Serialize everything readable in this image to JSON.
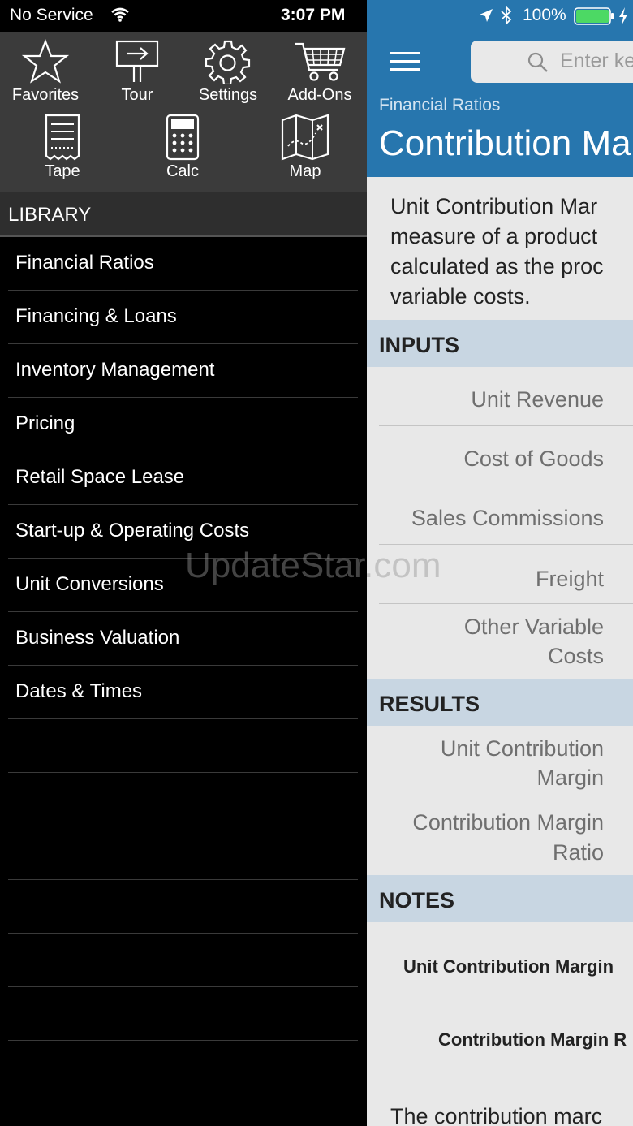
{
  "status_bar": {
    "carrier": "No Service",
    "time": "3:07 PM",
    "battery": "100%"
  },
  "toolbar": {
    "items": [
      {
        "label": "Favorites",
        "icon": "star-icon"
      },
      {
        "label": "Tour",
        "icon": "tour-icon"
      },
      {
        "label": "Settings",
        "icon": "gear-icon"
      },
      {
        "label": "Add-Ons",
        "icon": "cart-icon"
      },
      {
        "label": "Tape",
        "icon": "tape-icon"
      },
      {
        "label": "Calc",
        "icon": "calculator-icon"
      },
      {
        "label": "Map",
        "icon": "map-icon"
      }
    ]
  },
  "library": {
    "header": "LIBRARY",
    "items": [
      "Financial Ratios",
      "Financing & Loans",
      "Inventory Management",
      "Pricing",
      "Retail Space Lease",
      "Start-up & Operating Costs",
      "Unit Conversions",
      "Business Valuation",
      "Dates & Times"
    ]
  },
  "detail": {
    "search_placeholder": "Enter ke",
    "breadcrumb": "Financial Ratios",
    "title": "Contribution Ma",
    "description": [
      "Unit Contribution Mar",
      "measure of a product",
      "calculated as the proc",
      "variable costs."
    ],
    "inputs_header": "INPUTS",
    "inputs": [
      "Unit Revenue",
      "Cost of Goods",
      "Sales Commissions",
      "Freight",
      "Other Variable",
      "Costs"
    ],
    "results_header": "RESULTS",
    "results": [
      "Unit Contribution",
      "Margin",
      "Contribution Margin",
      "Ratio"
    ],
    "notes_header": "NOTES",
    "notes": [
      "Unit Contribution Margin",
      "Contribution Margin R",
      "The contribution marc"
    ]
  },
  "watermark": "UpdateStar.com",
  "colors": {
    "accent_blue": "#2776ae",
    "section_bg": "#c8d6e2",
    "battery_green": "#4cd964"
  }
}
